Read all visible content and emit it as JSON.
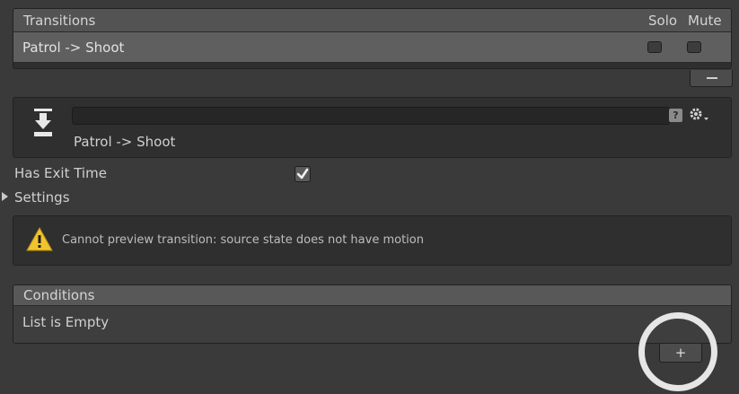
{
  "transitions": {
    "title": "Transitions",
    "solo_label": "Solo",
    "mute_label": "Mute",
    "items": [
      {
        "label": "Patrol -> Shoot",
        "solo": false,
        "mute": false
      }
    ],
    "remove_label": "–"
  },
  "detail": {
    "name_value": "",
    "help_icon": "?",
    "label": "Patrol -> Shoot"
  },
  "settings": {
    "has_exit_time_label": "Has Exit Time",
    "has_exit_time": true,
    "settings_label": "Settings"
  },
  "warning": {
    "text": "Cannot preview transition: source state does not have motion"
  },
  "conditions": {
    "title": "Conditions",
    "empty_text": "List is Empty",
    "add_label": "+"
  },
  "colors": {
    "background": "#3a3a3a",
    "warning_yellow": "#f0c42c",
    "highlight": "#e6e6e6"
  }
}
